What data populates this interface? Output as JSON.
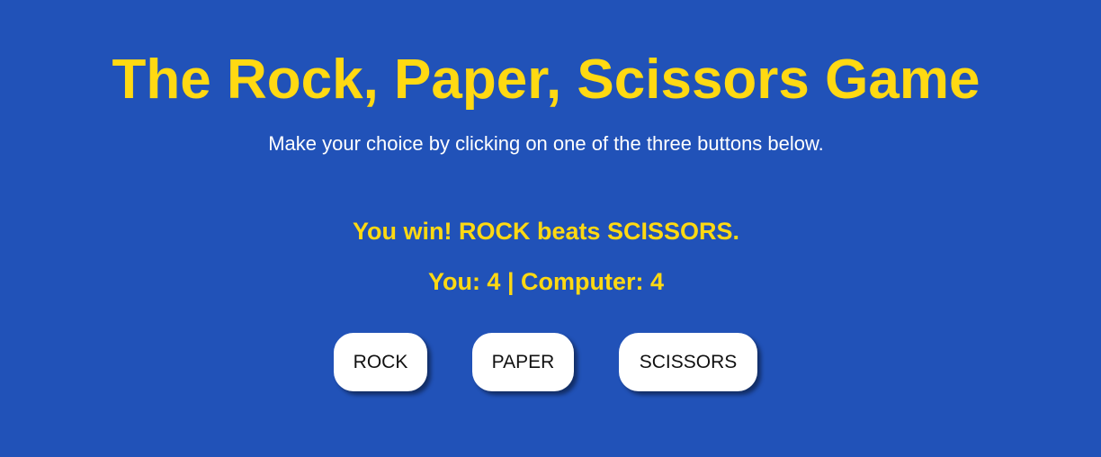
{
  "header": {
    "title": "The Rock, Paper, Scissors Game",
    "subtitle": "Make your choice by clicking on one of the three buttons below."
  },
  "game": {
    "result": "You win! ROCK beats SCISSORS.",
    "score_text": "You: 4 | Computer: 4"
  },
  "choices": {
    "rock": "ROCK",
    "paper": "PAPER",
    "scissors": "SCISSORS"
  },
  "colors": {
    "background": "#2152b8",
    "accent": "#ffd912",
    "button": "#ffffff"
  }
}
